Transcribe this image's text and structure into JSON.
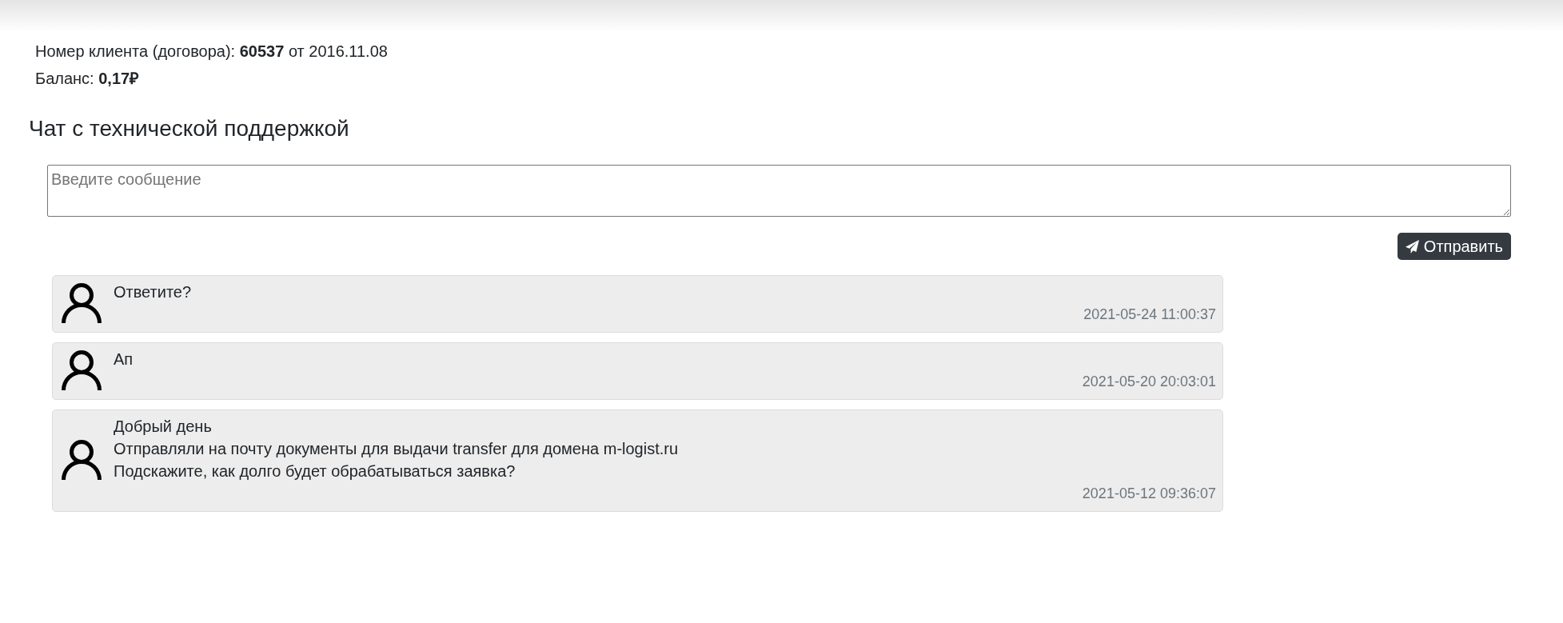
{
  "account": {
    "client_line": "Номер клиента (договора): **60537** от 2016.11.08",
    "balance_line": "Баланс: **0,17₽**"
  },
  "chat": {
    "title": "Чат с технической поддержкой",
    "message_field": {
      "placeholder": "Введите сообщение"
    },
    "send_button": {
      "label": "Отправить"
    },
    "messages": [
      {
        "text": "Ответите?",
        "time": "2021-05-24 11:00:37"
      },
      {
        "text": "Ап",
        "time": "2021-05-20 20:03:01"
      },
      {
        "text": "Добрый день\nОтправляли на почту документы для выдачи transfer для домена m-logist.ru\nПодскажите, как долго будет обрабатываться заявка?",
        "time": "2021-05-12 09:36:07"
      }
    ]
  }
}
